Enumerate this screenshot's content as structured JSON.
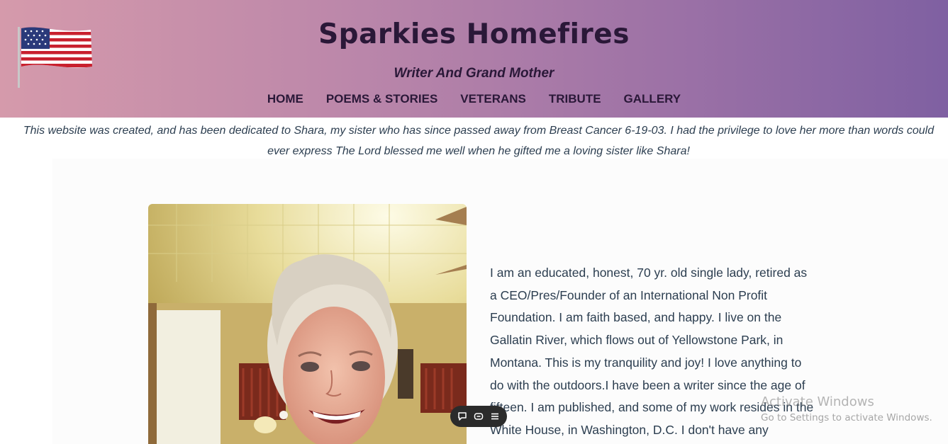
{
  "header": {
    "title": "Sparkies Homefires",
    "tagline": "Writer And Grand Mother",
    "nav": [
      "HOME",
      "POEMS & STORIES",
      "VETERANS",
      "TRIBUTE",
      "GALLERY"
    ],
    "gradient_colors": [
      "#d59aab",
      "#7f60a2"
    ]
  },
  "dedication": "This website was created, and has been dedicated to Shara, my sister who has since passed away from Breast Cancer 6-19-03. I had the privilege to love her more than words could ever express The Lord blessed me well when he gifted me a loving sister like Shara!",
  "bio": "I am an educated, honest, 70 yr. old single lady, retired as a CEO/Pres/Founder of an International Non Profit Foundation. I am faith based, and happy. I live on the Gallatin River, which flows out of Yellowstone Park, in Montana. This is my tranquility and joy! I love anything to do with the outdoors.I have been a writer since the age of fifteen. I am published, and some of my work resides in the White House, in Washington, D.C. I don't have any",
  "toolbar_icons": [
    "chat-bubble-icon",
    "caption-icon",
    "menu-icon"
  ],
  "watermark": {
    "title": "Activate Windows",
    "subtitle": "Go to Settings to activate Windows."
  },
  "colors": {
    "text_dark": "#2a1838",
    "body_text": "#2c3e50"
  }
}
